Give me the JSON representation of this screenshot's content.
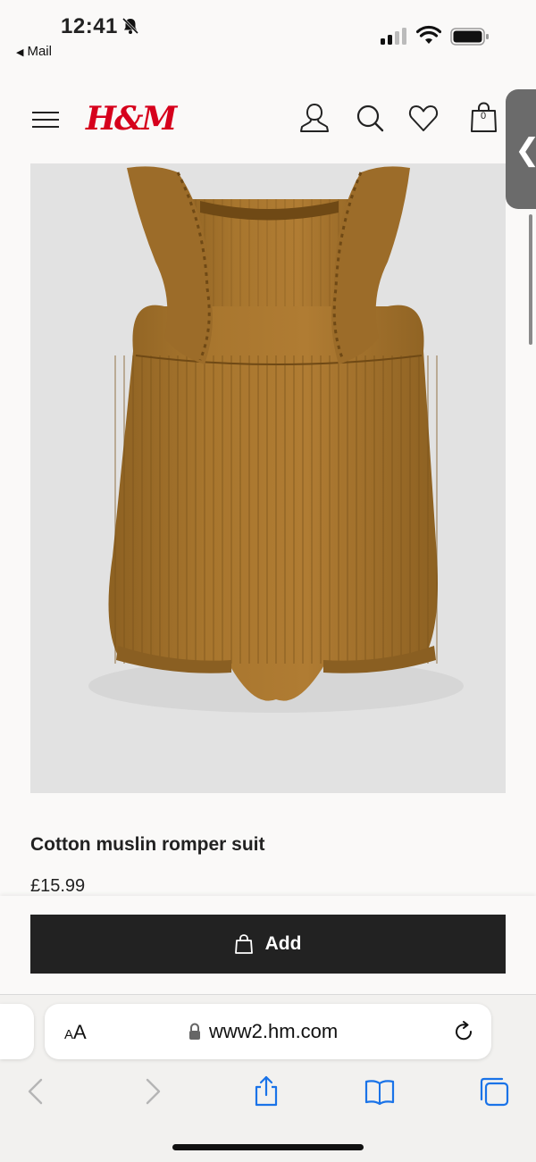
{
  "status_bar": {
    "time": "12:41",
    "back_label": "Mail",
    "icons": [
      "bell-slash-icon",
      "signal-icon",
      "wifi-icon",
      "battery-icon"
    ]
  },
  "header": {
    "logo": "H&M",
    "brand_color": "#d6001c",
    "bag_count": "0",
    "icons": [
      "hamburger-menu-icon",
      "account-icon",
      "search-icon",
      "heart-icon",
      "shopping-bag-icon"
    ]
  },
  "product": {
    "name": "Cotton muslin romper suit",
    "price": "£15.99",
    "image_bg": "#e2e2e2",
    "garment_color": "#a8762e"
  },
  "add_button": {
    "label": "Add",
    "bg": "#222222"
  },
  "browser": {
    "text_size_label_small": "A",
    "text_size_label_large": "A",
    "url": "www2.hm.com",
    "accent": "#1a73e8",
    "toolbar_icons": [
      "back-arrow-icon",
      "forward-arrow-icon",
      "share-icon",
      "bookmarks-icon",
      "tabs-icon"
    ]
  }
}
